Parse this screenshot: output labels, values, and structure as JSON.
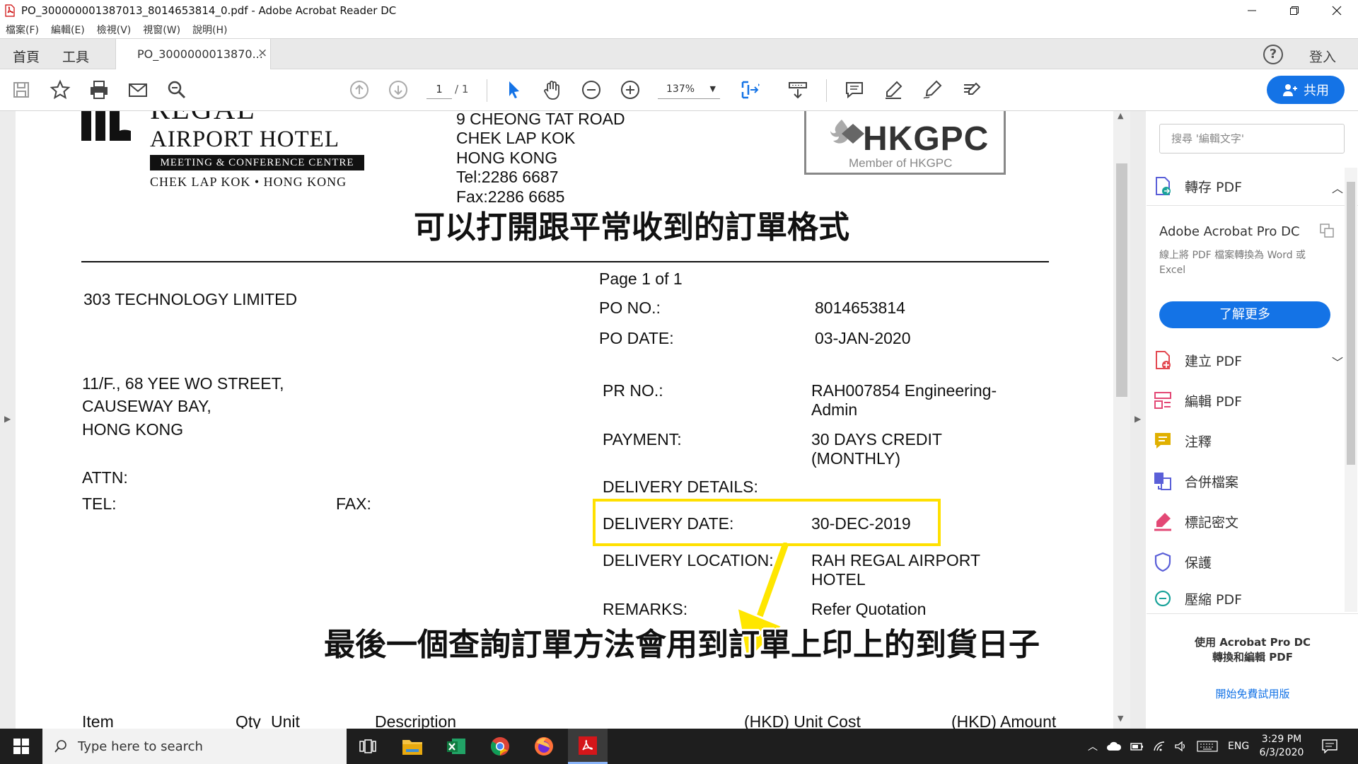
{
  "window": {
    "title": "PO_300000001387013_8014653814_0.pdf - Adobe Acrobat Reader DC"
  },
  "menu": [
    "檔案(F)",
    "編輯(E)",
    "檢視(V)",
    "視窗(W)",
    "說明(H)"
  ],
  "tabs": {
    "home": "首頁",
    "tools": "工具",
    "document": "PO_3000000013870...",
    "close": "×",
    "login": "登入"
  },
  "toolbar": {
    "page_current": "1",
    "page_total": "/ 1",
    "zoom": "137%",
    "share": "共用"
  },
  "document": {
    "hotel_word": "REGAL",
    "hotel_name": "AIRPORT HOTEL",
    "hotel_sub": "MEETING & CONFERENCE CENTRE",
    "hotel_loc": "CHEK LAP KOK • HONG KONG",
    "addr1": "9 CHEONG TAT ROAD",
    "addr2": "CHEK LAP KOK",
    "addr3": "HONG KONG",
    "tel": "Tel:2286 6687",
    "fax": "Fax:2286 6685",
    "hkgpc": "HKGPC",
    "hkgpc_member": "Member of HKGPC",
    "page_of": "Page 1 of 1",
    "vendor": "303 TECHNOLOGY LIMITED",
    "vendor_addr1": "11/F., 68 YEE WO STREET,",
    "vendor_addr2": "CAUSEWAY BAY,",
    "vendor_addr3": "HONG KONG",
    "attn": "ATTN:",
    "tel_label": "TEL:",
    "fax_label": "FAX:",
    "po_no_label": "PO NO.:",
    "po_no": "8014653814",
    "po_date_label": "PO DATE:",
    "po_date": "03-JAN-2020",
    "pr_no_label": "PR NO.:",
    "pr_no_1": "RAH007854 Engineering-",
    "pr_no_2": "Admin",
    "payment_label": "PAYMENT:",
    "payment_1": "30 DAYS CREDIT",
    "payment_2": "(MONTHLY)",
    "delivery_details_label": "DELIVERY DETAILS:",
    "delivery_date_label": "DELIVERY DATE:",
    "delivery_date": "30-DEC-2019",
    "delivery_location_label": "DELIVERY LOCATION:",
    "delivery_location_1": "RAH REGAL AIRPORT",
    "delivery_location_2": "HOTEL",
    "remarks_label": "REMARKS:",
    "remarks": "Refer Quotation",
    "col_item": "Item",
    "col_qty": "Qty",
    "col_unit": "Unit",
    "col_desc": "Description",
    "col_unit_cost": "(HKD) Unit Cost",
    "col_amount": "(HKD) Amount"
  },
  "overlay": {
    "subtitle_top": "可以打開跟平常收到的訂單格式",
    "subtitle_bottom": "最後一個查詢訂單方法會用到訂單上印上的到貨日子"
  },
  "right_panel": {
    "search_placeholder": "搜尋 '編輯文字'",
    "export_pdf": "轉存 PDF",
    "pro_title": "Adobe Acrobat Pro DC",
    "pro_desc": "線上將 PDF 檔案轉換為 Word 或 Excel",
    "learn_more": "了解更多",
    "tools": [
      {
        "label": "建立 PDF",
        "color": "#e34850"
      },
      {
        "label": "編輯 PDF",
        "color": "#e34875"
      },
      {
        "label": "注釋",
        "color": "#e0b000"
      },
      {
        "label": "合併檔案",
        "color": "#5a5fd8"
      },
      {
        "label": "標記密文",
        "color": "#e34875"
      },
      {
        "label": "保護",
        "color": "#5a5fd8"
      },
      {
        "label": "壓縮 PDF",
        "color": "#1aa39a"
      }
    ],
    "promo_1": "使用 Acrobat Pro DC",
    "promo_2": "轉換和編輯 PDF",
    "trial_link": "開始免費試用版"
  },
  "taskbar": {
    "search_placeholder": "Type here to search",
    "lang": "ENG",
    "time": "3:29 PM",
    "date": "6/3/2020"
  },
  "colors": {
    "accent": "#1473e6",
    "highlight": "#ffe000"
  }
}
